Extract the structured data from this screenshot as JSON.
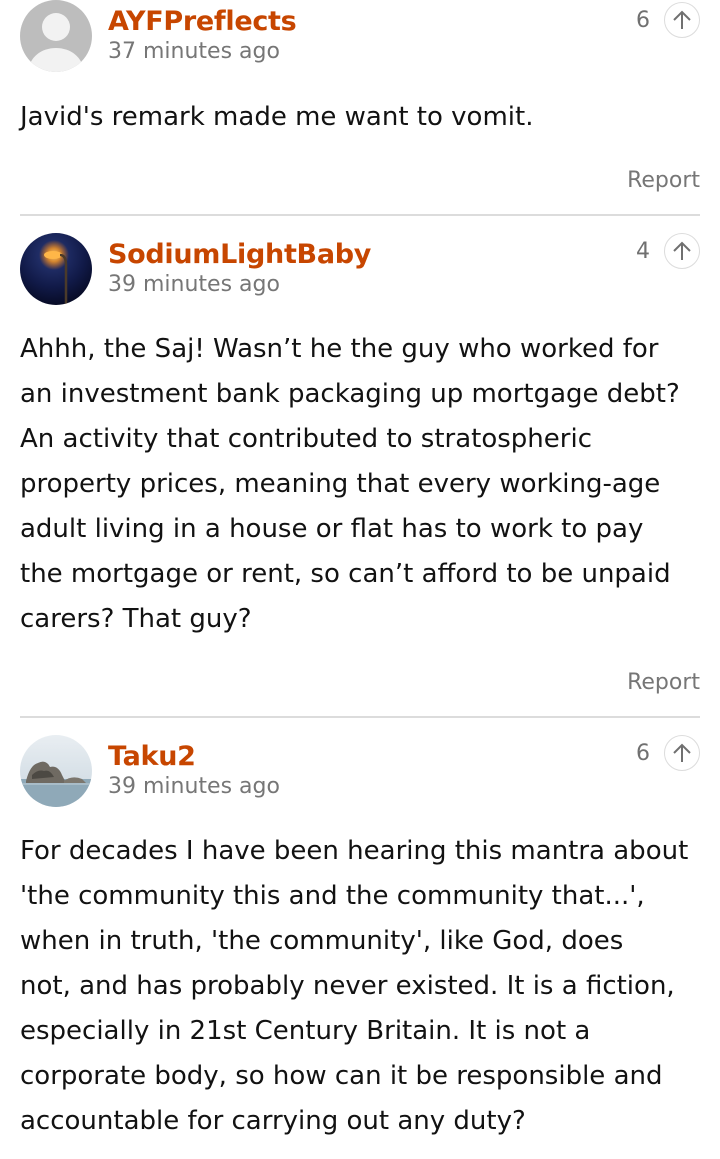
{
  "comments": [
    {
      "author": "AYFPreflects",
      "time": "37 minutes ago",
      "votes": "6",
      "avatar": "default-avatar",
      "lines": [
        "Javid's remark made me want to vomit."
      ],
      "report_label": "Report"
    },
    {
      "author": "SodiumLightBaby",
      "time": "39 minutes ago",
      "votes": "4",
      "avatar": "streetlight-avatar",
      "lines": [
        "Ahhh, the Saj! Wasn’t he the guy who worked for",
        "an investment bank packaging up mortgage debt?",
        "An activity that contributed to stratospheric",
        "property prices, meaning that every working-age",
        "adult living in a house or flat has to work to pay",
        "the mortgage or rent, so can’t afford to be unpaid",
        "carers? That guy?"
      ],
      "report_label": "Report"
    },
    {
      "author": "Taku2",
      "time": "39 minutes ago",
      "votes": "6",
      "avatar": "rocky-shore-avatar",
      "lines": [
        "For decades I have been hearing this mantra about",
        "'the community this and the community that...',",
        "when in truth, 'the community', like God, does",
        "not, and has probably never existed. It is a fiction,",
        "especially in 21st Century Britain. It is not a",
        "corporate body, so how can it be responsible and",
        "accountable for carrying out any duty?"
      ]
    }
  ],
  "colors": {
    "author": "#c74600",
    "meta": "#767676",
    "text": "#121212",
    "divider": "#dcdcdc"
  }
}
